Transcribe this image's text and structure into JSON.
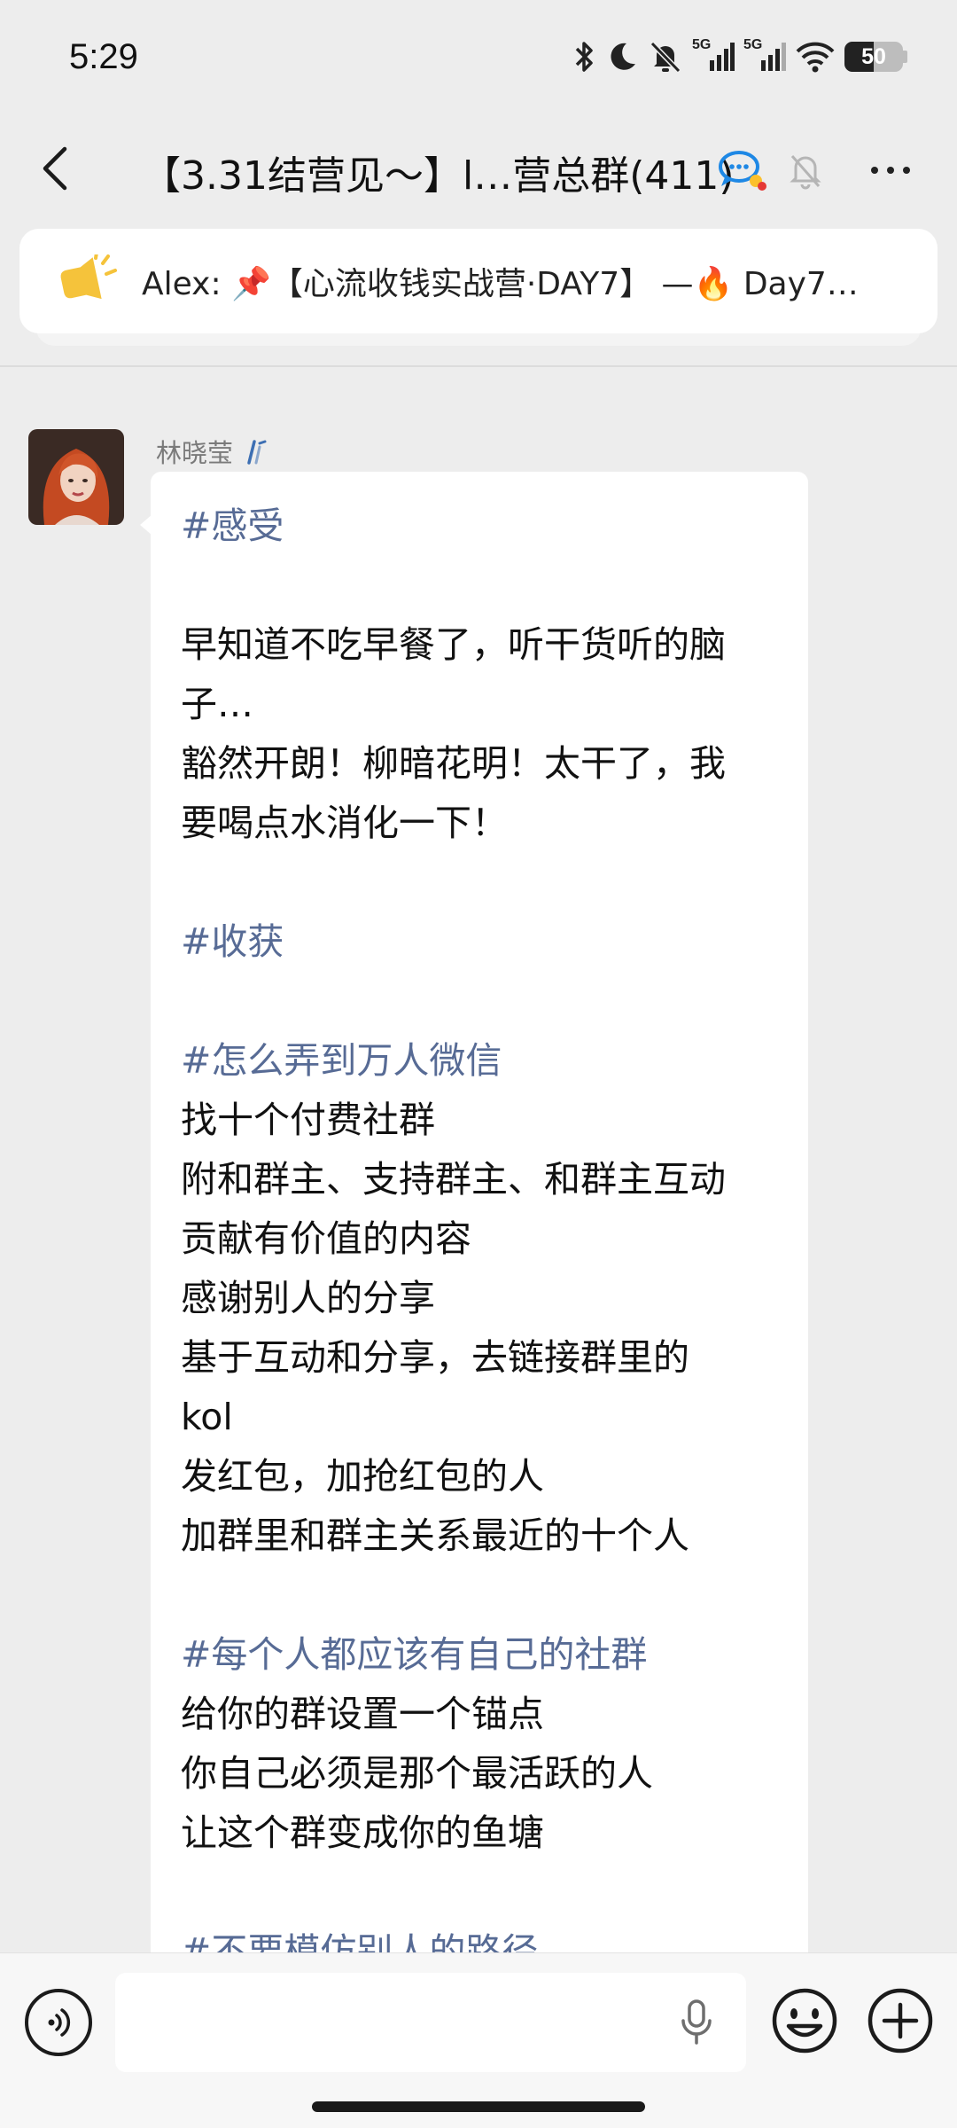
{
  "status_bar": {
    "time": "5:29",
    "network_1": "5G",
    "network_2": "5G",
    "battery_level": "50",
    "battery_fraction": 0.5
  },
  "header": {
    "title": "【3.31结营见～】l…营总群(411)",
    "back_icon": "chevron-left-icon",
    "muted": true,
    "more_icon": "more-dots-icon"
  },
  "pinned": {
    "text": "Alex: 📌【心流收钱实战营·DAY7】 —🔥 Day7…",
    "icon": "announcement-horn-icon",
    "accent": "#f5c33b"
  },
  "message": {
    "sender": "林晓莹",
    "lines": [
      {
        "text": "#感受",
        "tag": true
      },
      {
        "text": "",
        "tag": false
      },
      {
        "text": "早知道不吃早餐了，听干货听的脑",
        "tag": false
      },
      {
        "text": "子…",
        "tag": false
      },
      {
        "text": "豁然开朗！柳暗花明！太干了，我",
        "tag": false
      },
      {
        "text": "要喝点水消化一下！",
        "tag": false
      },
      {
        "text": "",
        "tag": false
      },
      {
        "text": "#收获",
        "tag": true
      },
      {
        "text": "",
        "tag": false
      },
      {
        "text": "#怎么弄到万人微信",
        "tag": true
      },
      {
        "text": "找十个付费社群",
        "tag": false
      },
      {
        "text": "附和群主、支持群主、和群主互动",
        "tag": false
      },
      {
        "text": "贡献有价值的内容",
        "tag": false
      },
      {
        "text": "感谢别人的分享",
        "tag": false
      },
      {
        "text": "基于互动和分享，去链接群里的",
        "tag": false
      },
      {
        "text": "kol",
        "tag": false
      },
      {
        "text": "发红包，加抢红包的人",
        "tag": false
      },
      {
        "text": "加群里和群主关系最近的十个人",
        "tag": false
      },
      {
        "text": "",
        "tag": false
      },
      {
        "text": "#每个人都应该有自己的社群",
        "tag": true
      },
      {
        "text": "给你的群设置一个锚点",
        "tag": false
      },
      {
        "text": "你自己必须是那个最活跃的人",
        "tag": false
      },
      {
        "text": "让这个群变成你的鱼塘",
        "tag": false
      },
      {
        "text": "",
        "tag": false
      },
      {
        "text": "#不要模仿别人的路径",
        "tag": true
      }
    ]
  },
  "input_bar": {
    "value": "",
    "placeholder": ""
  },
  "colors": {
    "background": "#ededed",
    "bubble": "#ffffff",
    "tag_link": "#576b95",
    "input_bar": "#f7f7f7"
  }
}
